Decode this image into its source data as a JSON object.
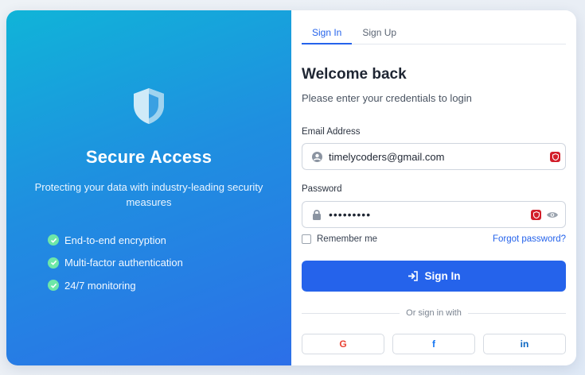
{
  "brand": {
    "title": "Secure Access",
    "subtitle": "Protecting your data with industry-leading security measures",
    "features": [
      "End-to-end encryption",
      "Multi-factor authentication",
      "24/7 monitoring"
    ]
  },
  "tabs": [
    {
      "label": "Sign In",
      "active": true
    },
    {
      "label": "Sign Up",
      "active": false
    }
  ],
  "form": {
    "title": "Welcome back",
    "subtitle": "Please enter your credentials to login",
    "email_label": "Email Address",
    "email_value": "timelycoders@gmail.com",
    "password_label": "Password",
    "password_value": "•••••••••",
    "remember_label": "Remember me",
    "forgot_label": "Forgot password?",
    "submit_label": "Sign In",
    "divider_label": "Or sign in with"
  },
  "social": [
    {
      "icon": "google-icon",
      "glyph": "G",
      "color": "#ea4335"
    },
    {
      "icon": "facebook-icon",
      "glyph": "f",
      "color": "#1877f2"
    },
    {
      "icon": "linkedin-icon",
      "glyph": "in",
      "color": "#0a66c2"
    }
  ],
  "colors": {
    "accent": "#2563eb",
    "panel_gradient_start": "#10b4d8",
    "panel_gradient_end": "#2c6fe8",
    "check": "#6ee7a8",
    "badge": "#d21f2b"
  }
}
